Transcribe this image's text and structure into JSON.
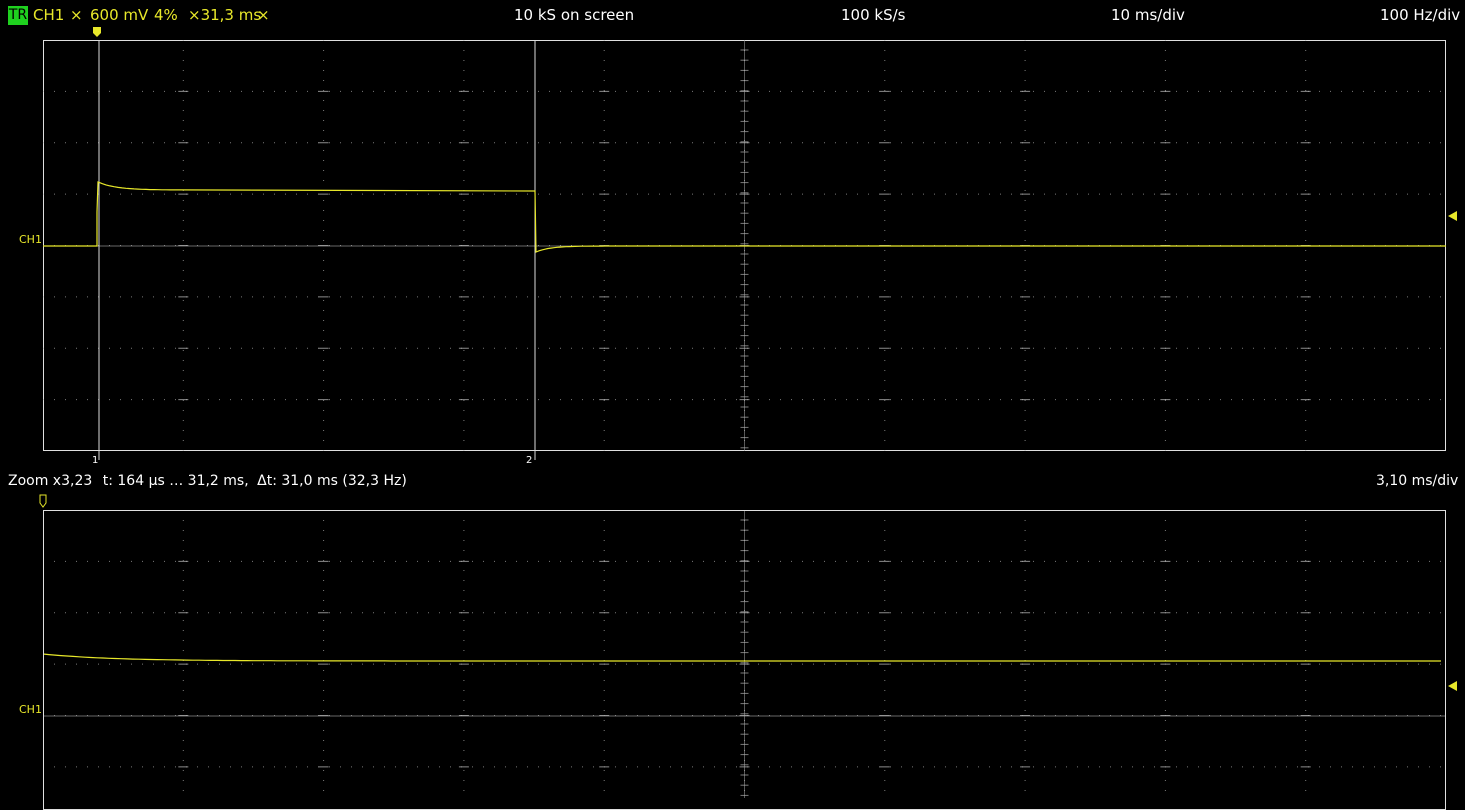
{
  "top_bar": {
    "trigger_badge": "TR",
    "channel": "CH1",
    "channel_icon": "cross-icon",
    "volts": "600 mV",
    "percent": "4%",
    "time_cursor": "×31,3 ms",
    "close_icon": "close-icon",
    "samples_on_screen": "10 kS on screen",
    "sample_rate": "100 kS/s",
    "time_per_div": "10 ms/div",
    "freq_per_div": "100 Hz/div"
  },
  "main_panel": {
    "channel_label": "CH1",
    "cursor_labels": [
      "1",
      "2"
    ]
  },
  "zoom_bar": {
    "zoom_factor": "Zoom x3,23",
    "time_range": "t: 164 µs … 31,2 ms,",
    "delta": "Δt: 31,0 ms (32,3 Hz)",
    "time_per_div": "3,10 ms/div"
  },
  "zoom_panel": {
    "channel_label": "CH1"
  },
  "colors": {
    "trace": "#e8e82a",
    "trigger_badge": "#1fd11f",
    "grid": "#b0b0b0",
    "frame": "#e0e0e0"
  }
}
